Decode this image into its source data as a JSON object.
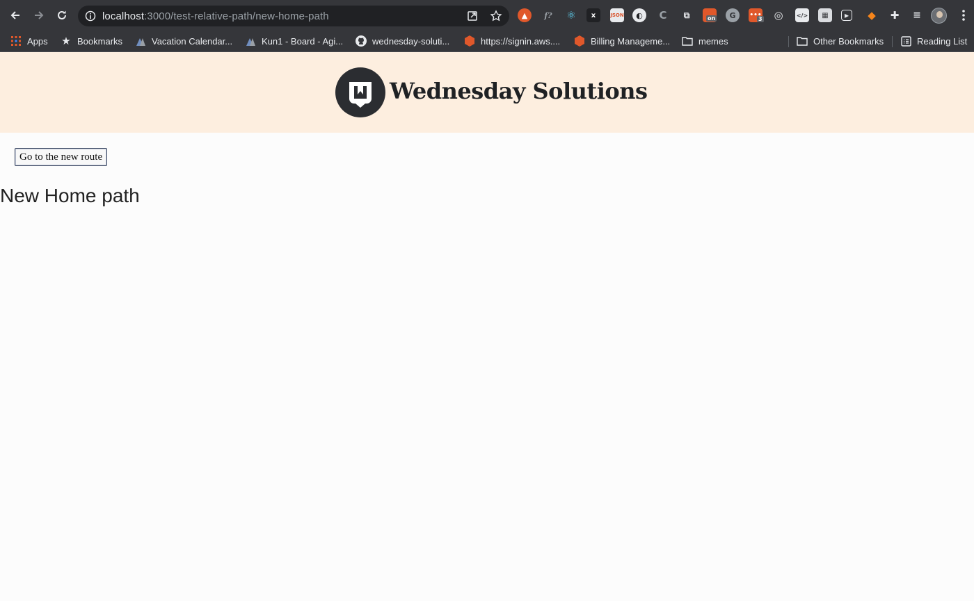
{
  "browser": {
    "url_host": "localhost",
    "url_path": ":3000/test-relative-path/new-home-path",
    "extension_badges": {
      "on_badge": "on",
      "count_badge": "3"
    },
    "bookmarks": [
      {
        "label": "Apps",
        "icon": "apps-grid-icon"
      },
      {
        "label": "Bookmarks",
        "icon": "star-icon"
      },
      {
        "label": "Vacation Calendar...",
        "icon": "atlassian-icon"
      },
      {
        "label": "Kun1 - Board - Agi...",
        "icon": "atlassian-icon"
      },
      {
        "label": "wednesday-soluti...",
        "icon": "github-icon"
      },
      {
        "label": "https://signin.aws....",
        "icon": "aws-hexagon-icon"
      },
      {
        "label": "Billing Manageme...",
        "icon": "aws-hexagon-icon"
      },
      {
        "label": "memes",
        "icon": "folder-icon"
      },
      {
        "label": "Other Bookmarks",
        "icon": "folder-icon"
      },
      {
        "label": "Reading List",
        "icon": "reading-list-icon"
      }
    ]
  },
  "header": {
    "brand": "Wednesday Solutions",
    "logo_color": "#2b2d31",
    "background": "#fdeedf"
  },
  "main": {
    "route_button_label": "Go to the new route",
    "heading": "New Home path"
  }
}
